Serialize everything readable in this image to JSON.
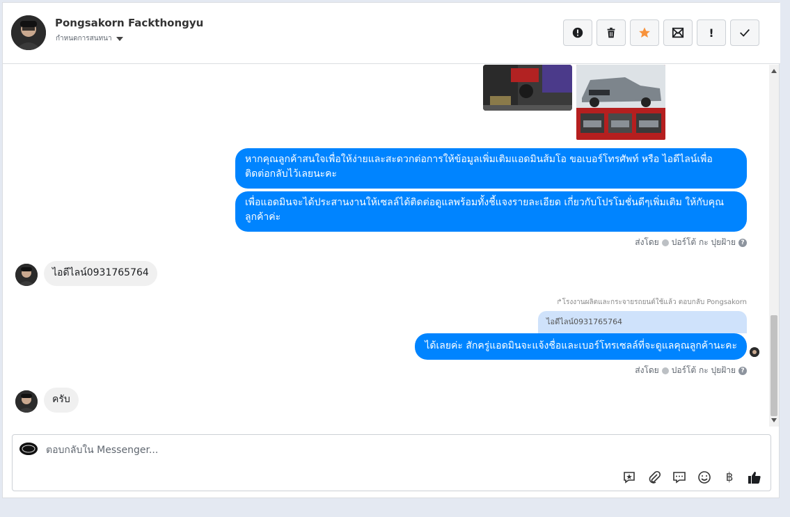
{
  "header": {
    "contact_name": "Pongsakorn Fackthongyu",
    "assign_label": "กำหนดการสนทนา",
    "actions": [
      {
        "name": "mark-spam-icon",
        "glyph": "!"
      },
      {
        "name": "trash-icon"
      },
      {
        "name": "star-icon"
      },
      {
        "name": "mark-unread-icon"
      },
      {
        "name": "mark-important-button",
        "glyph": "!"
      },
      {
        "name": "done-check-icon"
      }
    ]
  },
  "thread": {
    "msg_out_1": "หากคุณลูกค้าสนใจเพื่อให้ง่ายและสะดวกต่อการให้ข้อมูลเพิ่มเติมแอดมินส้มโอ ขอเบอร์โทรศัพท์ หรือ ไอดีไลน์เพื่อติดต่อกลับไว้เลยนะคะ",
    "msg_out_2": "เพื่อแอดมินจะได้ประสานงานให้เซลล์ได้ติดต่อดูแลพร้อมทั้งชี้แจงรายละเอียด เกี่ยวกับโปรโมชั่นดีๆเพิ่มเติม ให้กับคุณลูกค้าค่ะ",
    "sent_by_label_1": "ส่งโดย",
    "sent_by_name_1": "ปอร์โต้ กะ ปุยฝ้าย",
    "msg_in_1": "ไอดีไลน์0931765764",
    "reply_note": "↱โรงงานผลิตและกระจายรถยนต์ใช้แล้ว ตอบกลับ Pongsakorn",
    "quoted_text": "ไอดีไลน์0931765764",
    "msg_out_3": "ได้เลยค่ะ สักครู่แอดมินจะแจ้งชื่อและเบอร์โทรเซลล์ที่จะดูแลคุณลูกค้านะคะ",
    "sent_by_label_2": "ส่งโดย",
    "sent_by_name_2": "ปอร์โต้ กะ ปุยฝ้าย",
    "msg_in_2": "ครับ"
  },
  "composer": {
    "placeholder": "ตอบกลับใน Messenger...",
    "tools": [
      "saved-reply-icon",
      "attachment-icon",
      "comment-icon",
      "emoji-icon",
      "baht-currency-icon",
      "like-thumb-icon"
    ],
    "baht_glyph": "฿"
  },
  "colors": {
    "outgoing_bubble": "#0084ff",
    "incoming_bubble": "#f0f0f0",
    "quoted_bubble": "#cfe2fb",
    "star": "#f7923b"
  }
}
